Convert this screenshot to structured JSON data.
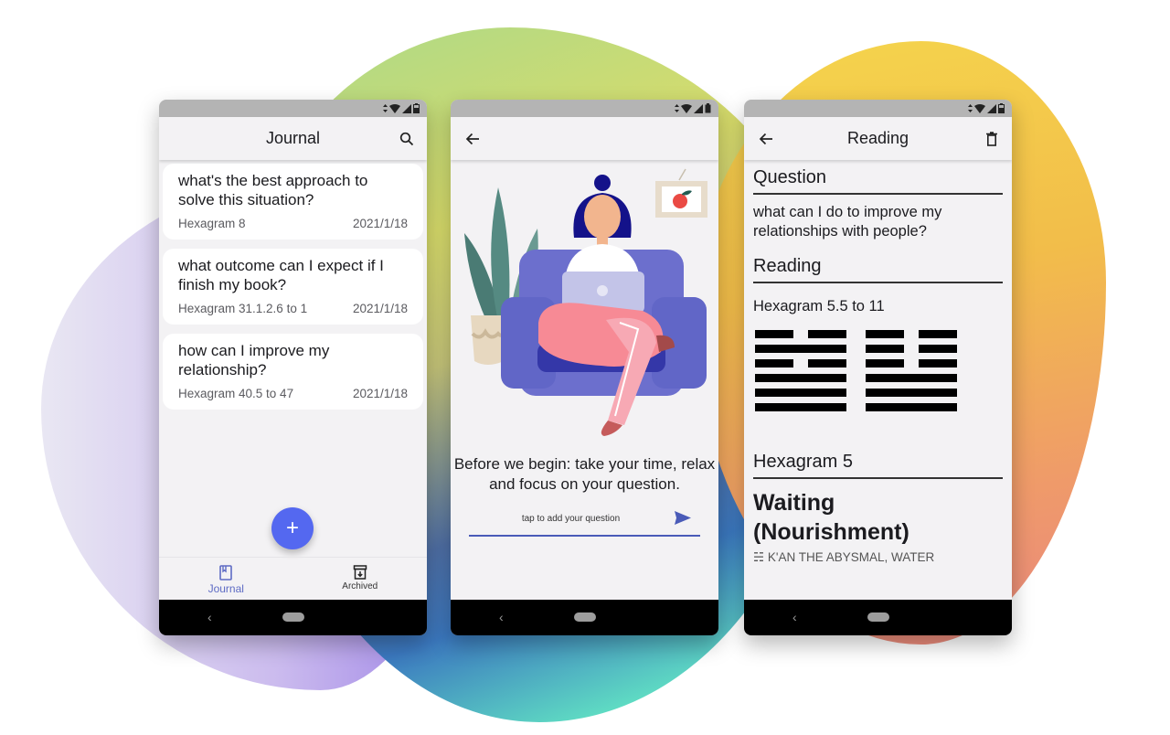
{
  "statusbar": {
    "icons": [
      "data-arrows-icon",
      "wifi-icon",
      "signal-icon",
      "battery-icon"
    ]
  },
  "journal_screen": {
    "title": "Journal",
    "search_icon": "search-icon",
    "entries": [
      {
        "question": "what's the best approach to solve this situation?",
        "hexagram": "Hexagram 8",
        "date": "2021/1/18"
      },
      {
        "question": "what outcome can I expect if I finish my book?",
        "hexagram": "Hexagram 31.1.2.6 to 1",
        "date": "2021/1/18"
      },
      {
        "question": "how can I improve my relationship?",
        "hexagram": "Hexagram 40.5 to 47",
        "date": "2021/1/18"
      }
    ],
    "fab_label": "+",
    "bottom_nav": [
      {
        "label": "Journal",
        "icon": "book-icon",
        "active": true
      },
      {
        "label": "Archived",
        "icon": "archive-icon",
        "active": false
      }
    ],
    "accent_color": "#5468f0"
  },
  "intro_screen": {
    "back_icon": "arrow-back-icon",
    "intro_text": "Before we begin: take your time, relax and focus on your question.",
    "question_placeholder": "tap to add your question",
    "question_value": "",
    "send_icon": "send-icon"
  },
  "reading_screen": {
    "title": "Reading",
    "back_icon": "arrow-back-icon",
    "delete_icon": "trash-icon",
    "question_heading": "Question",
    "question": "what can I do to improve my relationships with people?",
    "reading_heading": "Reading",
    "reading_label": "Hexagram 5.5 to 11",
    "hexagram_from": {
      "number": 5,
      "lines_top_to_bottom": [
        "broken",
        "solid",
        "broken",
        "solid",
        "solid",
        "solid"
      ]
    },
    "hexagram_to": {
      "number": 11,
      "lines_top_to_bottom": [
        "broken",
        "broken",
        "broken",
        "solid",
        "solid",
        "solid"
      ]
    },
    "hexagram_heading": "Hexagram 5",
    "hexagram_name_line1": "Waiting",
    "hexagram_name_line2": "(Nourishment)",
    "trigram_symbol": "☵",
    "trigram": "K'AN THE ABYSMAL, WATER"
  },
  "system_nav": {
    "back": "‹"
  }
}
